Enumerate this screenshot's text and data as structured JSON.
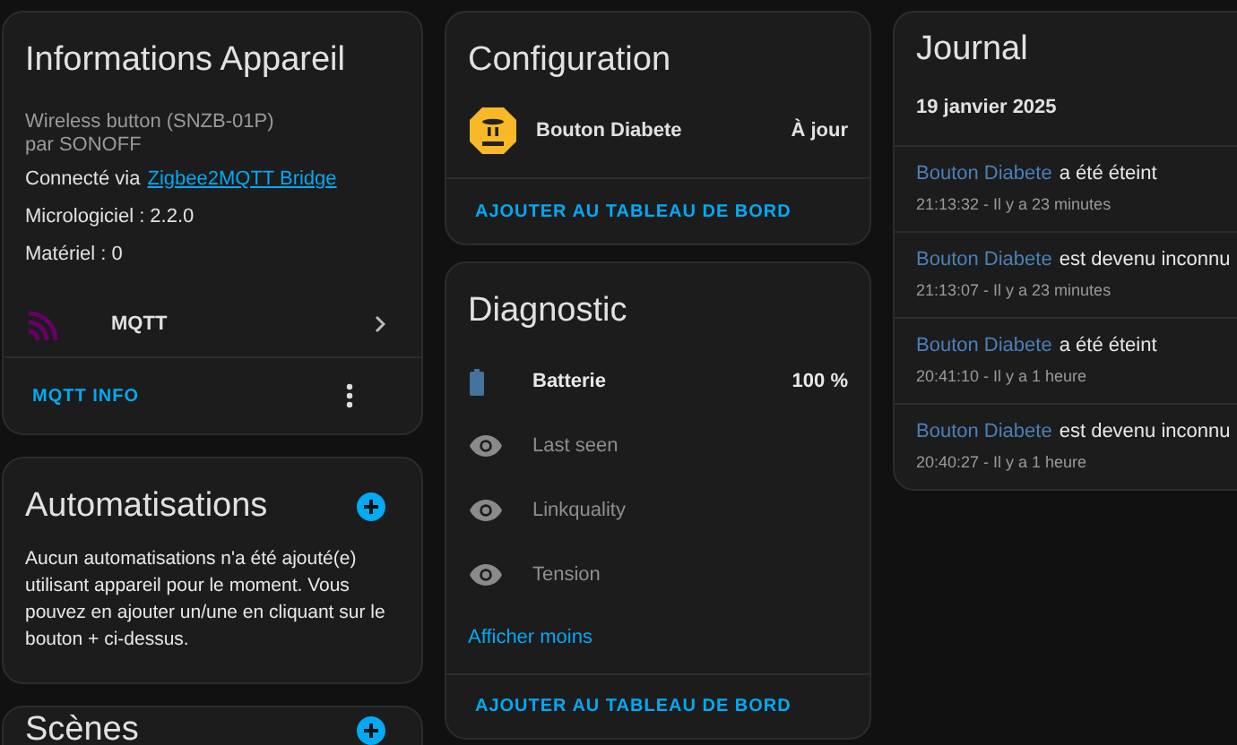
{
  "device_info": {
    "title": "Informations Appareil",
    "model": "Wireless button (SNZB-01P)",
    "manufacturer": "par SONOFF",
    "connected_prefix": "Connecté via",
    "connected_link": "Zigbee2MQTT Bridge",
    "firmware": "Micrologiciel : 2.2.0",
    "hardware": "Matériel : 0",
    "integration": "MQTT",
    "action": "MQTT INFO"
  },
  "automations": {
    "title": "Automatisations",
    "text": "Aucun automatisations n'a été ajouté(e) utilisant appareil pour le moment. Vous pouvez en ajouter un/une en cliquant sur le bouton + ci-dessus."
  },
  "scenes": {
    "title": "Scènes"
  },
  "configuration": {
    "title": "Configuration",
    "entity": "Bouton Diabete",
    "state": "À jour",
    "action": "AJOUTER AU TABLEAU DE BORD"
  },
  "diagnostic": {
    "title": "Diagnostic",
    "rows": [
      {
        "kind": "battery",
        "label": "Batterie",
        "value": "100 %",
        "disabled": false
      },
      {
        "kind": "hidden",
        "label": "Last seen",
        "disabled": true
      },
      {
        "kind": "hidden",
        "label": "Linkquality",
        "disabled": true
      },
      {
        "kind": "hidden",
        "label": "Tension",
        "disabled": true
      }
    ],
    "toggle": "Afficher moins",
    "action": "AJOUTER AU TABLEAU DE BORD"
  },
  "journal": {
    "title": "Journal",
    "date": "19 janvier 2025",
    "entries": [
      {
        "entity": "Bouton Diabete",
        "message": "a été éteint",
        "time": "21:13:32 - Il y a 23 minutes"
      },
      {
        "entity": "Bouton Diabete",
        "message": "est devenu inconnu",
        "time": "21:13:07 - Il y a 23 minutes"
      },
      {
        "entity": "Bouton Diabete",
        "message": "a été éteint",
        "time": "20:41:10 - Il y a 1 heure"
      },
      {
        "entity": "Bouton Diabete",
        "message": "est devenu inconnu",
        "time": "20:40:27 - Il y a 1 heure"
      }
    ]
  }
}
